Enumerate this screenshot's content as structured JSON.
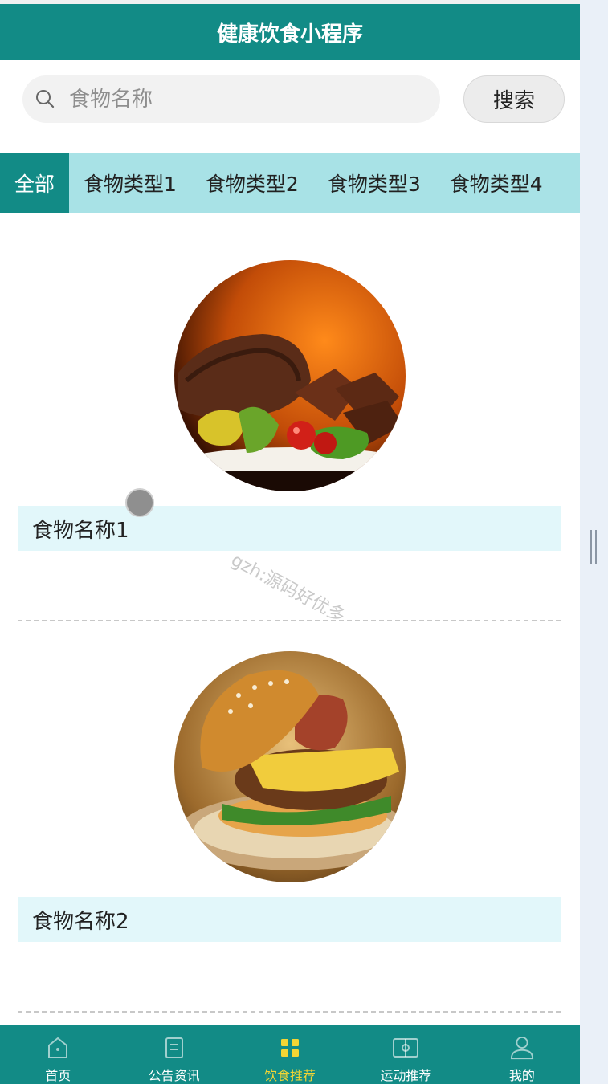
{
  "app": {
    "title": "健康饮食小程序"
  },
  "search": {
    "placeholder": "食物名称",
    "button_label": "搜索"
  },
  "tabs": [
    {
      "label": "全部",
      "active": true
    },
    {
      "label": "食物类型1",
      "active": false
    },
    {
      "label": "食物类型2",
      "active": false
    },
    {
      "label": "食物类型3",
      "active": false
    },
    {
      "label": "食物类型4",
      "active": false
    }
  ],
  "foods": [
    {
      "name": "食物名称1",
      "image": "grilled-steak-plate"
    },
    {
      "name": "食物名称2",
      "image": "cheeseburger"
    }
  ],
  "watermark": "gzh:源码好优多",
  "bottom_nav": [
    {
      "label": "首页",
      "icon": "home-icon",
      "active": false
    },
    {
      "label": "公告资讯",
      "icon": "notice-icon",
      "active": false
    },
    {
      "label": "饮食推荐",
      "icon": "grid-icon",
      "active": true
    },
    {
      "label": "运动推荐",
      "icon": "sport-icon",
      "active": false
    },
    {
      "label": "我的",
      "icon": "user-icon",
      "active": false
    }
  ],
  "colors": {
    "primary": "#128b86",
    "tab_bar": "#a8e2e6",
    "card_title_bg": "#e2f7fa",
    "nav_active": "#f3d534"
  }
}
